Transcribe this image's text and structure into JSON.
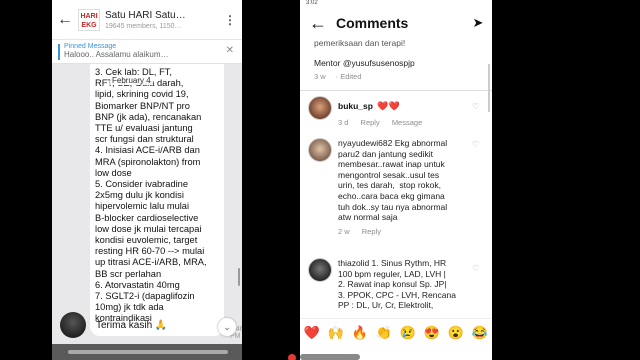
{
  "telegram": {
    "title": "Satu HARI Satu…",
    "subtitle": "19645 members, 1150…",
    "logo_text": "HARI EKG",
    "pinned": {
      "label": "Pinned Message",
      "text": "Halooo.. Assalamu alaikum…"
    },
    "date_badge": "February 4",
    "message": "3. Cek lab: DL, FT,\nRFT, SE, Gula darah,\nlipid, skrining covid 19,\nBiomarker BNP/NT pro\nBNP (jk ada), rencanakan\nTTE u/ evaluasi jantung\nscr fungsi dan struktural\n4. Inisiasi ACE-i/ARB dan\nMRA (spironolakton) from\nlow dose\n5. Consider ivabradine\n2x5mg dulu jk kondisi\nhipervolemic lalu mulai\nB-blocker cardioselective\nlow dose jk mulai tercapai\nkondisi euvolemic, target\nresting HR 60-70 --> mulai\nup titrasi ACE-i/ARB, MRA,\nBB scr perlahan\n6. Atorvastatin 40mg\n7. SGLT2-i (dapaglifozin\n10mg) jk tdk ada\nkontraindikasi",
    "reply_text": "Terima kasih 🙏",
    "reply_time": "7:46 PM"
  },
  "instagram": {
    "status_time": "3:02",
    "title": "Comments",
    "partial_line": "pemeriksaan dan terapi!",
    "mentor_line": "Mentor @yusufsusenospjp",
    "mentor_meta": {
      "age": "3 w",
      "edited": "· Edited"
    },
    "comments": [
      {
        "user": "buku_sp",
        "text": "❤️❤️",
        "age": "3 d",
        "reply": "Reply",
        "message": "Message"
      },
      {
        "user": "nyayudewi682",
        "text": "nyayudewi682 Ekg abnormal\nparu2 dan jantung sedikit\nmembesar..rawat inap untuk\nmengontrol sesak..usul tes\nurin, tes darah,  stop rokok,\necho..cara baca ekg gimana\ntuh dok..sy tau nya abnormal\natw normal saja",
        "age": "2 w",
        "reply": "Reply"
      },
      {
        "user": "thiazolid",
        "text": "thiazolid 1. Sinus Rythm, HR\n100 bpm reguler, LAD, LVH |\n2. Rawat inap konsul Sp. JP|\n3. PPOK, CPC - LVH, Rencana\nPP : DL, Ur, Cr, Elektrolit,"
      }
    ],
    "emojis": [
      "❤️",
      "🙌",
      "🔥",
      "👏",
      "😢",
      "😍",
      "😮",
      "😂"
    ],
    "colors": {
      "like": "#e0245e",
      "muted": "#8e8e8e"
    }
  }
}
